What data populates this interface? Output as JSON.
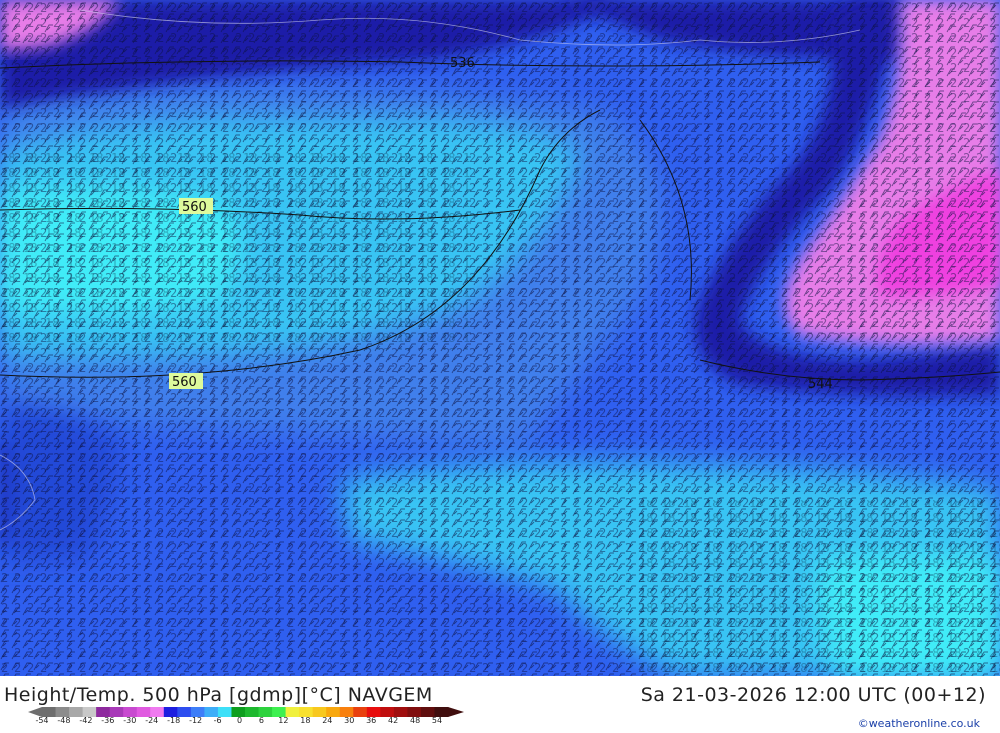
{
  "map": {
    "contour_labels": [
      "536",
      "560",
      "560",
      "544"
    ],
    "colors": {
      "ocean_deep": "#1a1aa8",
      "ocean_blue": "#2f5ff0",
      "mid_blue": "#3f7fec",
      "light_cyan": "#38c4f4",
      "bright_cyan": "#40ecf8",
      "pink": "#e77de8",
      "magenta": "#ef3fe0",
      "label_bg": "#ddfa9c"
    }
  },
  "footer": {
    "title": "Height/Temp. 500 hPa [gdmp][°C] NAVGEM",
    "datetime": "Sa 21-03-2026 12:00 UTC (00+12)",
    "credit": "©weatheronline.co.uk"
  },
  "legend": {
    "ticks": [
      "-54",
      "-48",
      "-42",
      "-36",
      "-30",
      "-24",
      "-18",
      "-12",
      "-6",
      "0",
      "6",
      "12",
      "18",
      "24",
      "30",
      "36",
      "42",
      "48",
      "54"
    ],
    "colors": [
      "#6e6e6e",
      "#8c8c8c",
      "#a8a8a8",
      "#c8c8c8",
      "#8e2a9e",
      "#a83ab8",
      "#c84ad0",
      "#e05ae0",
      "#f07af0",
      "#1e1ee0",
      "#2e4ef0",
      "#3e7ef8",
      "#3eaef8",
      "#3ee0f8",
      "#0e9e1e",
      "#1eb82e",
      "#2ed23e",
      "#3ef050",
      "#f0f03e",
      "#f8e02e",
      "#f8c81e",
      "#f8a80e",
      "#f8800e",
      "#e8400e",
      "#e80e0e",
      "#c00e0e",
      "#a00e0e",
      "#800e0e",
      "#600e0e",
      "#400e0e"
    ]
  }
}
